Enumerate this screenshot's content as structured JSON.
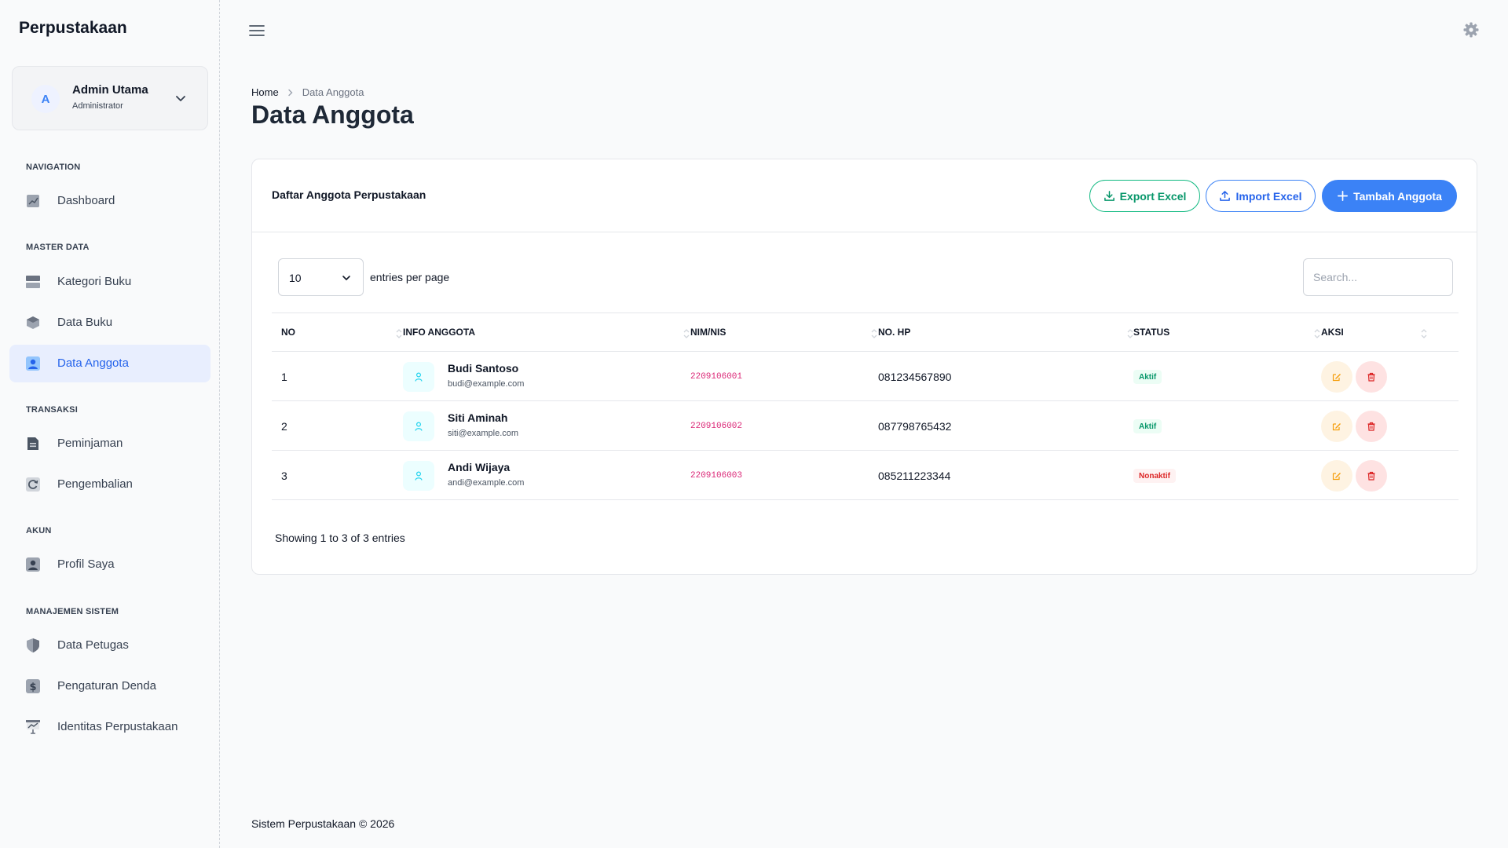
{
  "app": {
    "brand": "Perpustakaan"
  },
  "user": {
    "initial": "A",
    "name": "Admin Utama",
    "role": "Administrator"
  },
  "sidebar": {
    "sections": [
      {
        "title": "NAVIGATION",
        "items": [
          {
            "label": "Dashboard",
            "icon": "dashboard-icon"
          }
        ]
      },
      {
        "title": "MASTER DATA",
        "items": [
          {
            "label": "Kategori Buku",
            "icon": "category-icon"
          },
          {
            "label": "Data Buku",
            "icon": "book-icon"
          },
          {
            "label": "Data Anggota",
            "icon": "member-icon",
            "active": true
          }
        ]
      },
      {
        "title": "TRANSAKSI",
        "items": [
          {
            "label": "Peminjaman",
            "icon": "loan-icon"
          },
          {
            "label": "Pengembalian",
            "icon": "return-icon"
          }
        ]
      },
      {
        "title": "AKUN",
        "items": [
          {
            "label": "Profil Saya",
            "icon": "profile-icon"
          }
        ]
      },
      {
        "title": "MANAJEMEN SISTEM",
        "items": [
          {
            "label": "Data Petugas",
            "icon": "shield-icon"
          },
          {
            "label": "Pengaturan Denda",
            "icon": "dollar-icon"
          },
          {
            "label": "Identitas Perpustakaan",
            "icon": "library-icon"
          }
        ]
      }
    ]
  },
  "breadcrumb": {
    "home": "Home",
    "current": "Data Anggota"
  },
  "page": {
    "title": "Data Anggota"
  },
  "card": {
    "title": "Daftar Anggota Perpustakaan",
    "export_label": "Export Excel",
    "import_label": "Import Excel",
    "add_label": "Tambah Anggota"
  },
  "table_controls": {
    "entries_value": "10",
    "entries_label": "entries per page",
    "search_placeholder": "Search..."
  },
  "table": {
    "columns": [
      "NO",
      "INFO ANGGOTA",
      "NIM/NIS",
      "NO. HP",
      "STATUS",
      "AKSI"
    ],
    "rows": [
      {
        "no": "1",
        "name": "Budi Santoso",
        "email": "budi@example.com",
        "nim": "2209106001",
        "phone": "081234567890",
        "status": "Aktif"
      },
      {
        "no": "2",
        "name": "Siti Aminah",
        "email": "siti@example.com",
        "nim": "2209106002",
        "phone": "087798765432",
        "status": "Aktif"
      },
      {
        "no": "3",
        "name": "Andi Wijaya",
        "email": "andi@example.com",
        "nim": "2209106003",
        "phone": "085211223344",
        "status": "Nonaktif"
      }
    ]
  },
  "showing": "Showing 1 to 3 of 3 entries",
  "footer": "Sistem Perpustakaan © 2026",
  "colors": {
    "primary": "#3b82f6",
    "success": "#10b981",
    "danger": "#dc2626",
    "nim": "#db2777"
  }
}
